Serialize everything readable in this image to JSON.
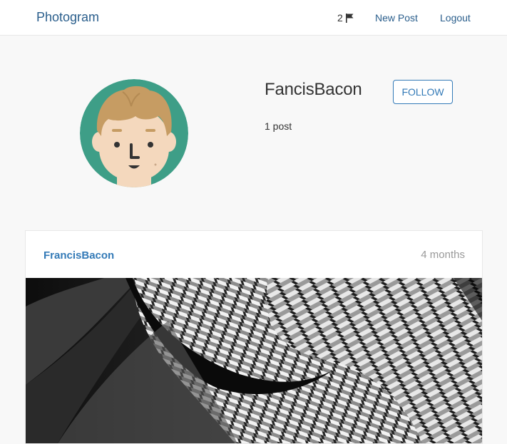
{
  "navbar": {
    "brand": "Photogram",
    "notifications_count": "2",
    "new_post_label": "New Post",
    "logout_label": "Logout"
  },
  "profile": {
    "username": "FancisBacon",
    "follow_label": "FOLLOW",
    "post_count": "1 post"
  },
  "post": {
    "author": "FrancisBacon",
    "time": "4 months"
  },
  "colors": {
    "link": "#337ab7",
    "avatar_bg": "#3e9e87",
    "muted": "#999999"
  },
  "icons": [
    "flag-icon"
  ]
}
